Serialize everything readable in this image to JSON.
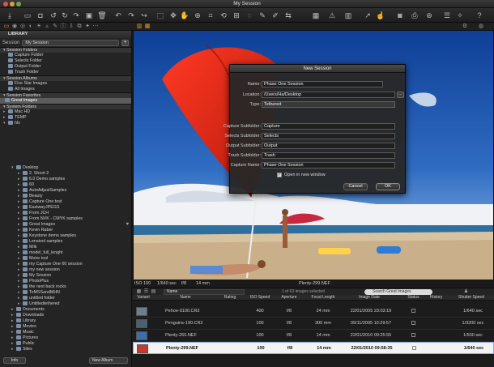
{
  "window": {
    "title": "My Session"
  },
  "library": {
    "header": "LIBRARY",
    "session_label": "Session",
    "session_value": "My Session",
    "sections": [
      {
        "title": "Session Folders",
        "items": [
          "Capture Folder",
          "Selects Folder",
          "Output Folder",
          "Trash Folder"
        ]
      },
      {
        "title": "Session Albums",
        "items": [
          "Five Star Images",
          "All Images"
        ]
      },
      {
        "title": "Session Favorites",
        "items": [
          "Great Images"
        ]
      },
      {
        "title": "System Folders",
        "items": [
          "Mac HD",
          "TEMP",
          "hls"
        ]
      }
    ],
    "tree": [
      "Desktop",
      "2. Shoot 2",
      "6.0 Demo samples",
      "60",
      "AutoAdjustSamples",
      "Beauty",
      "Capture One test",
      "EastwayJPEGS",
      "From JCH",
      "From NVK - CMYK samples",
      "Great Images",
      "Kevin Raber",
      "Keystone demo  samples",
      "Lenstool samples",
      "Milk",
      "model_full_lenght",
      "Moire tool",
      "my Capture One 60 session",
      "my new session",
      "My Session",
      "PhotoPlus",
      "the next back rocks",
      "ToMSSandMHN",
      "untitled folder",
      "Untitledtethered",
      "Documents",
      "Downloads",
      "Library",
      "Movies",
      "Music",
      "Pictures",
      "Public",
      "Sites"
    ],
    "info_button": "Info",
    "new_album_button": "New Album"
  },
  "viewer": {
    "iso": "ISO 100",
    "shutter": "1/640 sec",
    "aperture": "f/8",
    "focal": "14 mm",
    "filename": "Plenty-299.NEF"
  },
  "dialog": {
    "title": "New Session",
    "name_label": "Name:",
    "name_value": "Phase One Session",
    "location_label": "Location:",
    "location_value": "/Users/Ha/Desktop",
    "browse_label": "...",
    "type_label": "Type:",
    "type_value": "Tethered",
    "capture_label": "Capture Subfolder:",
    "capture_value": "Capture",
    "selects_label": "Selects Subfolder:",
    "selects_value": "Selects",
    "output_label": "Output Subfolder:",
    "output_value": "Output",
    "trash_label": "Trash Subfolder:",
    "trash_value": "Trash",
    "capname_label": "Capture Name:",
    "capname_value": "Phase One Session",
    "open_new_window_label": "Open in new window",
    "open_new_window_checked": "✓",
    "cancel": "Cancel",
    "ok": "OK"
  },
  "browser": {
    "sort_value": "Name",
    "count_text": "1 of 63 images selected",
    "search_placeholder": "Search Great Images",
    "columns": [
      "Variant",
      "Name",
      "Rating",
      "ISO Speed",
      "Aperture",
      "Focal Length",
      "Image Date",
      "Status",
      "History",
      "Shutter Speed"
    ],
    "rows": [
      {
        "name": "Pehoe-0100.CR2",
        "iso": "400",
        "aperture": "f/8",
        "focal": "24 mm",
        "date": "22/01/2005 23:03:19",
        "shutter": "1/640 sec",
        "thumb_color": "#6b7f8f"
      },
      {
        "name": "Penguins-190.CR2",
        "iso": "100",
        "aperture": "f/8",
        "focal": "300 mm",
        "date": "09/11/2005 10:29:57",
        "shutter": "1/3200 sec",
        "thumb_color": "#4d6070"
      },
      {
        "name": "Plenty-260.NEF",
        "iso": "100",
        "aperture": "f/8",
        "focal": "14 mm",
        "date": "22/01/2010 09:25:55",
        "shutter": "1/500 sec",
        "thumb_color": "#3d6ea8"
      },
      {
        "name": "Plenty-299.NEF",
        "iso": "100",
        "aperture": "f/8",
        "focal": "14 mm",
        "date": "22/01/2010 09:58:35",
        "shutter": "1/640 sec",
        "thumb_color": "#c83a2e",
        "selected": true
      }
    ]
  },
  "colors": {
    "accent": "#e8962e",
    "umbrella": "#e12a1c",
    "sky": "#2f6cc2",
    "sand": "#d8c3a0"
  }
}
